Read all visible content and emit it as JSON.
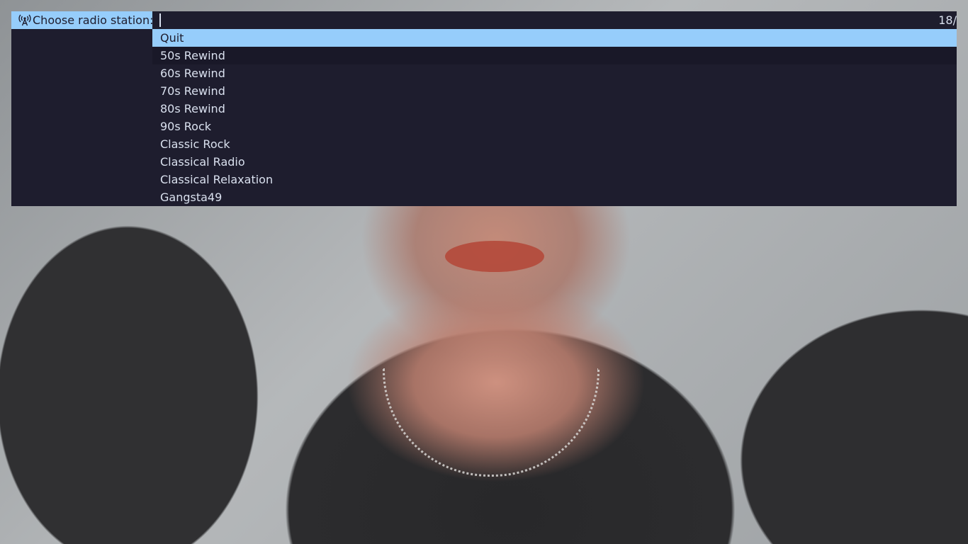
{
  "launcher": {
    "prompt_label": "Choose radio station:",
    "prompt_icon": "radio-tower-icon",
    "input_value": "",
    "count": "18/",
    "accent_color": "#96cdfb",
    "background_color": "#1e1d2e",
    "text_color": "#d9e0ee"
  },
  "stations": [
    {
      "label": "Quit",
      "selected": true
    },
    {
      "label": "50s Rewind",
      "selected": false
    },
    {
      "label": "60s Rewind",
      "selected": false
    },
    {
      "label": "70s Rewind",
      "selected": false
    },
    {
      "label": "80s Rewind",
      "selected": false
    },
    {
      "label": "90s Rock",
      "selected": false
    },
    {
      "label": "Classic Rock",
      "selected": false
    },
    {
      "label": "Classical Radio",
      "selected": false
    },
    {
      "label": "Classical Relaxation",
      "selected": false
    },
    {
      "label": "Gangsta49",
      "selected": false
    }
  ]
}
